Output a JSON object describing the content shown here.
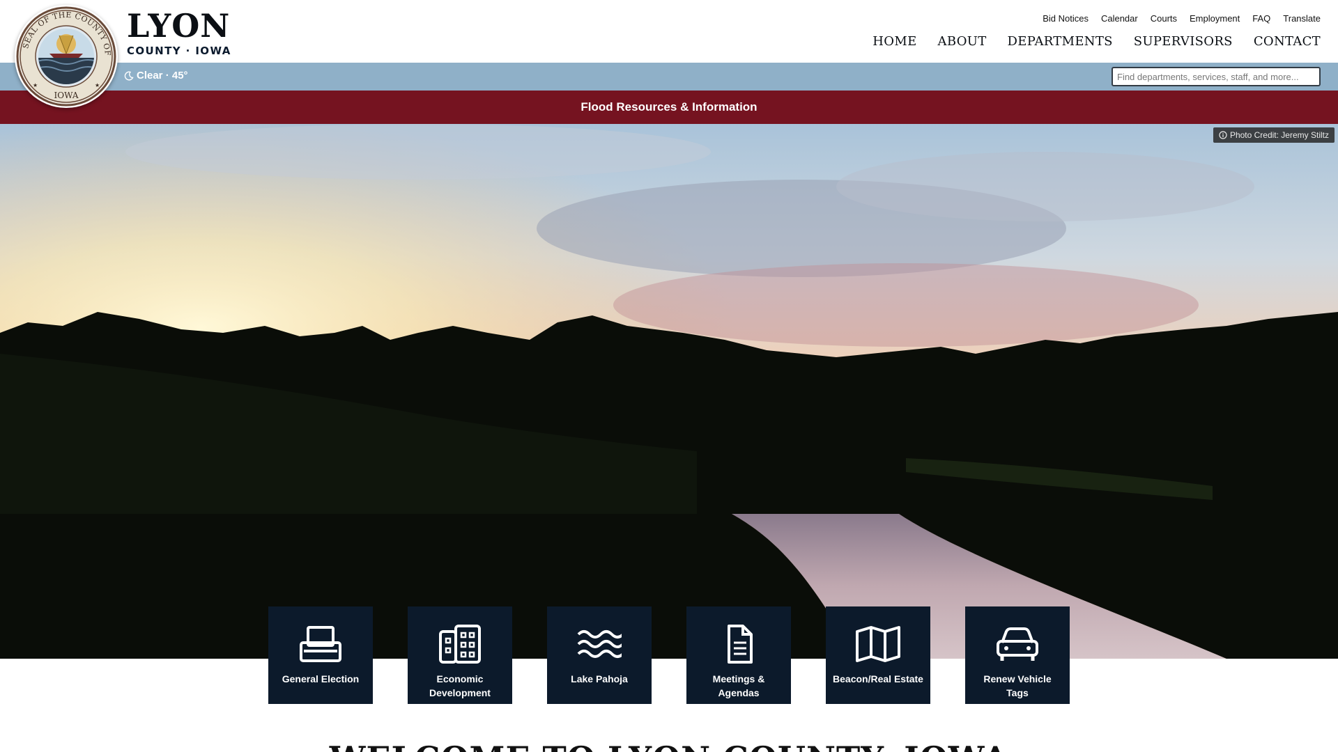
{
  "brand": {
    "name": "LYON",
    "subtitle": "COUNTY · IOWA",
    "seal_text": "SEAL OF THE COUNTY OF LYON",
    "seal_state": "IOWA"
  },
  "utility_nav": [
    {
      "label": "Bid Notices"
    },
    {
      "label": "Calendar"
    },
    {
      "label": "Courts"
    },
    {
      "label": "Employment"
    },
    {
      "label": "FAQ"
    },
    {
      "label": "Translate"
    }
  ],
  "main_nav": [
    {
      "label": "HOME"
    },
    {
      "label": "ABOUT"
    },
    {
      "label": "DEPARTMENTS"
    },
    {
      "label": "SUPERVISORS"
    },
    {
      "label": "CONTACT"
    }
  ],
  "weather": {
    "text": "Clear · 45°",
    "icon": "moon-icon"
  },
  "search": {
    "placeholder": "Find departments, services, staff, and more..."
  },
  "alert": {
    "label": "Flood Resources & Information"
  },
  "hero": {
    "photo_credit": "Photo Credit: Jeremy Stiltz"
  },
  "quick_links": [
    {
      "label": "General Election",
      "icon": "ballot-box-icon"
    },
    {
      "label": "Economic Development",
      "icon": "buildings-icon"
    },
    {
      "label": "Lake Pahoja",
      "icon": "water-waves-icon"
    },
    {
      "label": "Meetings & Agendas",
      "icon": "document-icon"
    },
    {
      "label": "Beacon/Real Estate",
      "icon": "map-icon"
    },
    {
      "label": "Renew Vehicle Tags",
      "icon": "car-icon"
    }
  ],
  "welcome": {
    "heading": "WELCOME TO LYON COUNTY, IOWA"
  },
  "colors": {
    "infobar": "#8fb0c8",
    "alert": "#751320",
    "tile": "#0c1a2b"
  }
}
